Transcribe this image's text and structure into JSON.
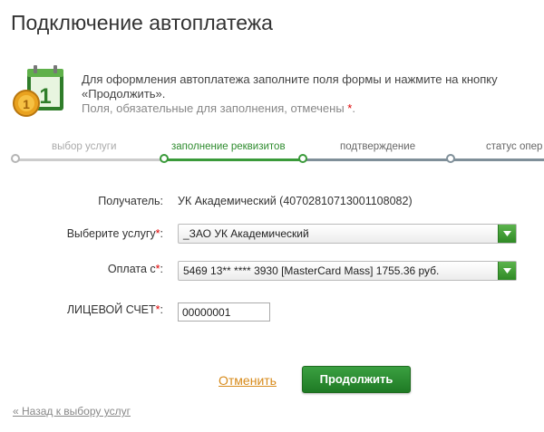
{
  "title": "Подключение автоплатежа",
  "info": {
    "line1": "Для оформления автоплатежа заполните поля формы и нажмите на кнопку",
    "line2": "«Продолжить».",
    "required_note": "Поля, обязательные для заполнения, отмечены",
    "star": "*",
    "period": "."
  },
  "steps": [
    {
      "label": "выбор услуги",
      "state": "done"
    },
    {
      "label": "заполнение реквизитов",
      "state": "active"
    },
    {
      "label": "подтверждение",
      "state": "todo"
    },
    {
      "label": "статус опер",
      "state": "todo"
    }
  ],
  "form": {
    "recipient_label": "Получатель:",
    "recipient_value": "УК Академический (40702810713001108082)",
    "service_label": "Выберите услугу",
    "service_value": "_ЗАО УК Академический",
    "payment_label": "Оплата с",
    "payment_value": "5469 13** **** 3930 [MasterCard Mass] 1755.36 руб.",
    "account_label": "ЛИЦЕВОЙ СЧЕТ",
    "account_value": "00000001",
    "star": "*",
    "colon": ":"
  },
  "actions": {
    "cancel": "Отменить",
    "continue": "Продолжить",
    "back": "« Назад к выбору услуг"
  },
  "colors": {
    "accent_green": "#2e8b2e",
    "link_orange": "#d78a1a",
    "required_red": "#dd0000"
  },
  "icons": {
    "calendar": "calendar-coin-icon",
    "dropdown": "chevron-down-icon"
  }
}
